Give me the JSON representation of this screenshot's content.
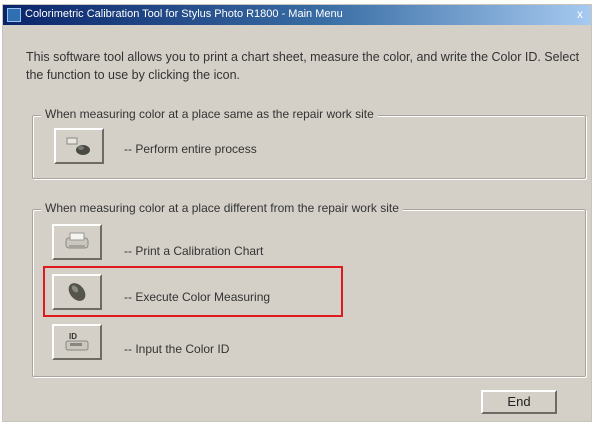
{
  "window": {
    "title": "Colorimetric Calibration Tool for Stylus Photo R1800 - Main Menu",
    "close_label": "x"
  },
  "intro_text": "This software tool allows you to print a chart sheet, measure the color, and write the Color ID. Select the function to use by clicking the icon.",
  "group_same_site": {
    "label": "When measuring color at a place same as the repair work site",
    "actions": [
      {
        "icon": "perform-process-icon",
        "label": "-- Perform entire process"
      }
    ]
  },
  "group_different_site": {
    "label": "When measuring color at a place different from the repair work site",
    "actions": [
      {
        "icon": "printer-icon",
        "label": "-- Print a Calibration Chart"
      },
      {
        "icon": "colorimeter-icon",
        "label": "-- Execute Color Measuring"
      },
      {
        "icon": "input-id-icon",
        "label": "-- Input the Color ID"
      }
    ]
  },
  "end_button_label": "End",
  "colors": {
    "title_bar": "#0a246a",
    "dialog_background": "#d4d0c8",
    "highlight": "#e0191e"
  }
}
